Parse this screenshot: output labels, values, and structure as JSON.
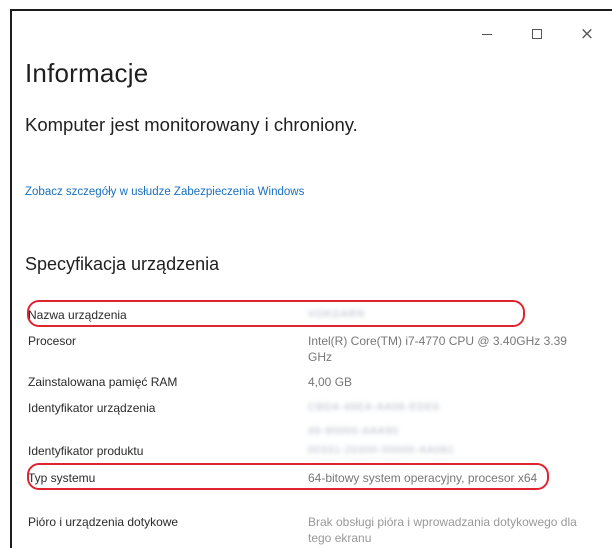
{
  "window": {
    "controls": {
      "minimize_icon": "minimize-icon",
      "maximize_icon": "maximize-icon",
      "close_glyph": "×"
    }
  },
  "page": {
    "title": "Informacje",
    "protection_status": "Komputer jest monitorowany i chroniony.",
    "security_link": "Zobacz szczegóły w usłudze Zabezpieczenia Windows"
  },
  "specs": {
    "section_title": "Specyfikacja urządzenia",
    "rows": [
      {
        "label": "Nazwa urządzenia",
        "value": "VOKGARN",
        "value_blurred": true
      },
      {
        "label": "Procesor",
        "value": "Intel(R) Core(TM) i7-4770 CPU @ 3.40GHz   3.39 GHz"
      },
      {
        "label": "Zainstalowana pamięć RAM",
        "value": "4,00 GB"
      },
      {
        "label": "Identyfikator urządzenia",
        "value": "CBDA-49EA-AA08-EDE6",
        "value_blurred": true,
        "extra": "49-90000-AAA90",
        "extra_blurred": true
      },
      {
        "label": "Identyfikator produktu",
        "value": "00331-20300-00000-AA081",
        "value_blurred": true
      },
      {
        "label": "Typ systemu",
        "value": "64-bitowy system operacyjny, procesor x64"
      },
      {
        "label": "Pióro i urządzenia dotykowe",
        "value": "Brak obsługi pióra i wprowadzania dotykowego dla tego ekranu"
      }
    ]
  },
  "annotation_color": "#e0242f"
}
